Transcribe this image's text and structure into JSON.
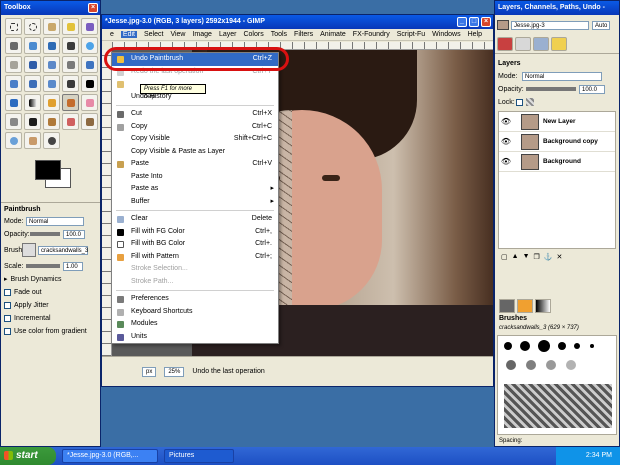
{
  "toolbox": {
    "title": "Toolbox",
    "options_title": "Paintbrush",
    "mode_label": "Mode:",
    "mode_value": "Normal",
    "opacity_label": "Opacity:",
    "opacity_value": "100.0",
    "brush_label": "Brush:",
    "brush_value": "cracksandwalls_3",
    "scale_label": "Scale:",
    "scale_value": "1.00",
    "brush_dynamics": "Brush Dynamics",
    "fade_out": "Fade out",
    "apply_jitter": "Apply Jitter",
    "incremental": "Incremental",
    "use_color_gradient": "Use color from gradient"
  },
  "main": {
    "title": "*Jesse.jpg-3.0 (RGB, 3 layers) 2592x1944 - GIMP",
    "menus": [
      "e",
      "Edit",
      "Select",
      "View",
      "Image",
      "Layer",
      "Colors",
      "Tools",
      "Filters",
      "Animate",
      "FX-Foundry",
      "Script-Fu",
      "Windows",
      "Help"
    ],
    "status_unit": "px",
    "status_zoom": "25%",
    "status_text": "Undo the last operation"
  },
  "edit_menu": {
    "items": [
      {
        "label": "Undo Paintbrush",
        "shortcut": "Ctrl+Z"
      },
      {
        "label": "Redo the last operation",
        "shortcut": "Ctrl+Y"
      },
      {
        "label": "",
        "shortcut": ""
      },
      {
        "label": "Undo History",
        "shortcut": ""
      },
      {
        "label": "Cut",
        "shortcut": "Ctrl+X"
      },
      {
        "label": "Copy",
        "shortcut": "Ctrl+C"
      },
      {
        "label": "Copy Visible",
        "shortcut": "Shift+Ctrl+C"
      },
      {
        "label": "Copy Visible & Paste as Layer",
        "shortcut": ""
      },
      {
        "label": "Paste",
        "shortcut": "Ctrl+V"
      },
      {
        "label": "Paste Into",
        "shortcut": ""
      },
      {
        "label": "Paste as",
        "shortcut": ""
      },
      {
        "label": "Buffer",
        "shortcut": ""
      },
      {
        "label": "Clear",
        "shortcut": "Delete"
      },
      {
        "label": "Fill with FG Color",
        "shortcut": "Ctrl+,"
      },
      {
        "label": "Fill with BG Color",
        "shortcut": "Ctrl+."
      },
      {
        "label": "Fill with Pattern",
        "shortcut": "Ctrl+;"
      },
      {
        "label": "Stroke Selection...",
        "shortcut": ""
      },
      {
        "label": "Stroke Path...",
        "shortcut": ""
      },
      {
        "label": "Preferences",
        "shortcut": ""
      },
      {
        "label": "Keyboard Shortcuts",
        "shortcut": ""
      },
      {
        "label": "Modules",
        "shortcut": ""
      },
      {
        "label": "Units",
        "shortcut": ""
      }
    ],
    "tooltip": "Press F1 for more help"
  },
  "layers_dock": {
    "title": "Layers, Channels, Paths, Undo -",
    "image_name": "Jesse.jpg-3",
    "auto": "Auto",
    "section": "Layers",
    "mode_label": "Mode:",
    "mode_value": "Normal",
    "opacity_label": "Opacity:",
    "opacity_value": "100.0",
    "lock_label": "Lock:",
    "layers": [
      "New Layer",
      "Background copy",
      "Background"
    ],
    "brushes_title": "Brushes",
    "brush_name": "cracksandwalls_3 (629 × 737)",
    "spacing_label": "Spacing:"
  },
  "taskbar": {
    "start": "start",
    "task1": "*Jesse.jpg-3.0 (RGB,...",
    "task2": "Pictures",
    "clock": "2:34 PM"
  },
  "colors": {
    "accent": "#316ac5",
    "highlight_ring": "#d81111"
  }
}
